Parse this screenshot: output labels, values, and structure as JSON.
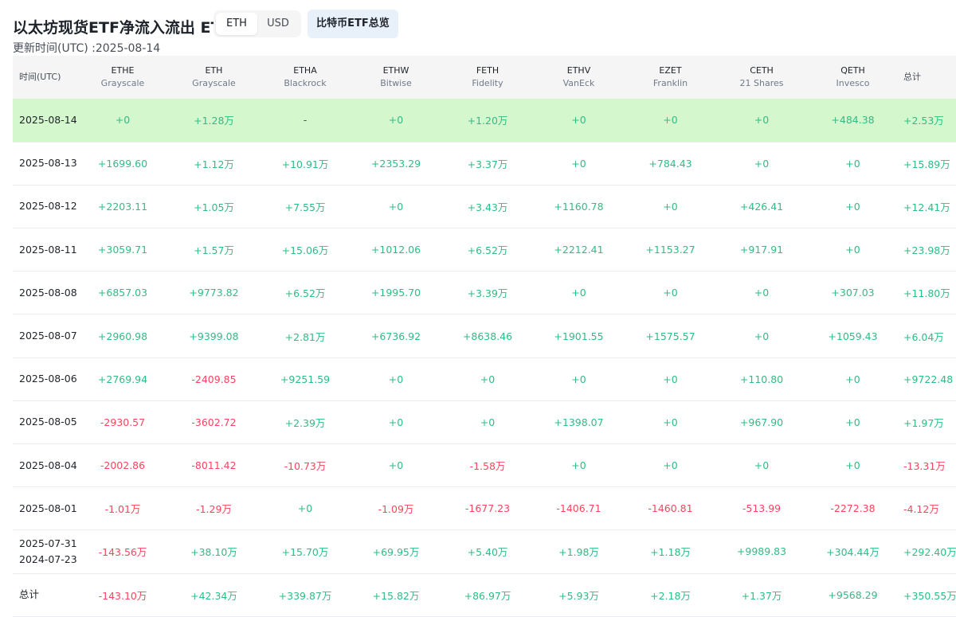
{
  "header": {
    "title": "以太坊现货ETF净流入流出 ETH",
    "updated": "更新时间(UTC) :2025-08-14",
    "unit_toggle": [
      {
        "label": "ETH",
        "active": true
      },
      {
        "label": "USD",
        "active": false
      }
    ],
    "btc_button": "比特币ETF总览"
  },
  "table": {
    "date_header": "时间(UTC)",
    "total_header": "总计",
    "funds": [
      {
        "ticker": "ETHE",
        "issuer": "Grayscale"
      },
      {
        "ticker": "ETH",
        "issuer": "Grayscale"
      },
      {
        "ticker": "ETHA",
        "issuer": "Blackrock"
      },
      {
        "ticker": "ETHW",
        "issuer": "Bitwise"
      },
      {
        "ticker": "FETH",
        "issuer": "Fidelity"
      },
      {
        "ticker": "ETHV",
        "issuer": "VanEck"
      },
      {
        "ticker": "EZET",
        "issuer": "Franklin"
      },
      {
        "ticker": "CETH",
        "issuer": "21 Shares"
      },
      {
        "ticker": "QETH",
        "issuer": "Invesco"
      }
    ],
    "rows": [
      {
        "date": "2025-08-14",
        "date2": "",
        "highlight": true,
        "cells": [
          "+0",
          "+1.28万",
          "-",
          "+0",
          "+1.20万",
          "+0",
          "+0",
          "+0",
          "+484.38",
          "+2.53万"
        ]
      },
      {
        "date": "2025-08-13",
        "date2": "",
        "highlight": false,
        "cells": [
          "+1699.60",
          "+1.12万",
          "+10.91万",
          "+2353.29",
          "+3.37万",
          "+0",
          "+784.43",
          "+0",
          "+0",
          "+15.89万"
        ]
      },
      {
        "date": "2025-08-12",
        "date2": "",
        "highlight": false,
        "cells": [
          "+2203.11",
          "+1.05万",
          "+7.55万",
          "+0",
          "+3.43万",
          "+1160.78",
          "+0",
          "+426.41",
          "+0",
          "+12.41万"
        ]
      },
      {
        "date": "2025-08-11",
        "date2": "",
        "highlight": false,
        "cells": [
          "+3059.71",
          "+1.57万",
          "+15.06万",
          "+1012.06",
          "+6.52万",
          "+2212.41",
          "+1153.27",
          "+917.91",
          "+0",
          "+23.98万"
        ]
      },
      {
        "date": "2025-08-08",
        "date2": "",
        "highlight": false,
        "cells": [
          "+6857.03",
          "+9773.82",
          "+6.52万",
          "+1995.70",
          "+3.39万",
          "+0",
          "+0",
          "+0",
          "+307.03",
          "+11.80万"
        ]
      },
      {
        "date": "2025-08-07",
        "date2": "",
        "highlight": false,
        "cells": [
          "+2960.98",
          "+9399.08",
          "+2.81万",
          "+6736.92",
          "+8638.46",
          "+1901.55",
          "+1575.57",
          "+0",
          "+1059.43",
          "+6.04万"
        ]
      },
      {
        "date": "2025-08-06",
        "date2": "",
        "highlight": false,
        "cells": [
          "+2769.94",
          "-2409.85",
          "+9251.59",
          "+0",
          "+0",
          "+0",
          "+0",
          "+110.80",
          "+0",
          "+9722.48"
        ]
      },
      {
        "date": "2025-08-05",
        "date2": "",
        "highlight": false,
        "cells": [
          "-2930.57",
          "-3602.72",
          "+2.39万",
          "+0",
          "+0",
          "+1398.07",
          "+0",
          "+967.90",
          "+0",
          "+1.97万"
        ]
      },
      {
        "date": "2025-08-04",
        "date2": "",
        "highlight": false,
        "cells": [
          "-2002.86",
          "-8011.42",
          "-10.73万",
          "+0",
          "-1.58万",
          "+0",
          "+0",
          "+0",
          "+0",
          "-13.31万"
        ]
      },
      {
        "date": "2025-08-01",
        "date2": "",
        "highlight": false,
        "cells": [
          "-1.01万",
          "-1.29万",
          "+0",
          "-1.09万",
          "-1677.23",
          "-1406.71",
          "-1460.81",
          "-513.99",
          "-2272.38",
          "-4.12万"
        ]
      },
      {
        "date": "2025-07-31",
        "date2": "2024-07-23",
        "highlight": false,
        "cells": [
          "-143.56万",
          "+38.10万",
          "+15.70万",
          "+69.95万",
          "+5.40万",
          "+1.98万",
          "+1.18万",
          "+9989.83",
          "+304.44万",
          "+292.40万"
        ]
      },
      {
        "date": "总计",
        "date2": "",
        "highlight": false,
        "cells": [
          "-143.10万",
          "+42.34万",
          "+339.87万",
          "+15.82万",
          "+86.97万",
          "+5.93万",
          "+2.18万",
          "+1.37万",
          "+9568.29",
          "+350.55万"
        ]
      }
    ]
  },
  "colors": {
    "positive": "#2ebd85",
    "negative": "#f6465d",
    "highlight_row": "#d5f7cd",
    "header_bg": "#f5f5f5",
    "button_bg": "#e8f0fa"
  }
}
